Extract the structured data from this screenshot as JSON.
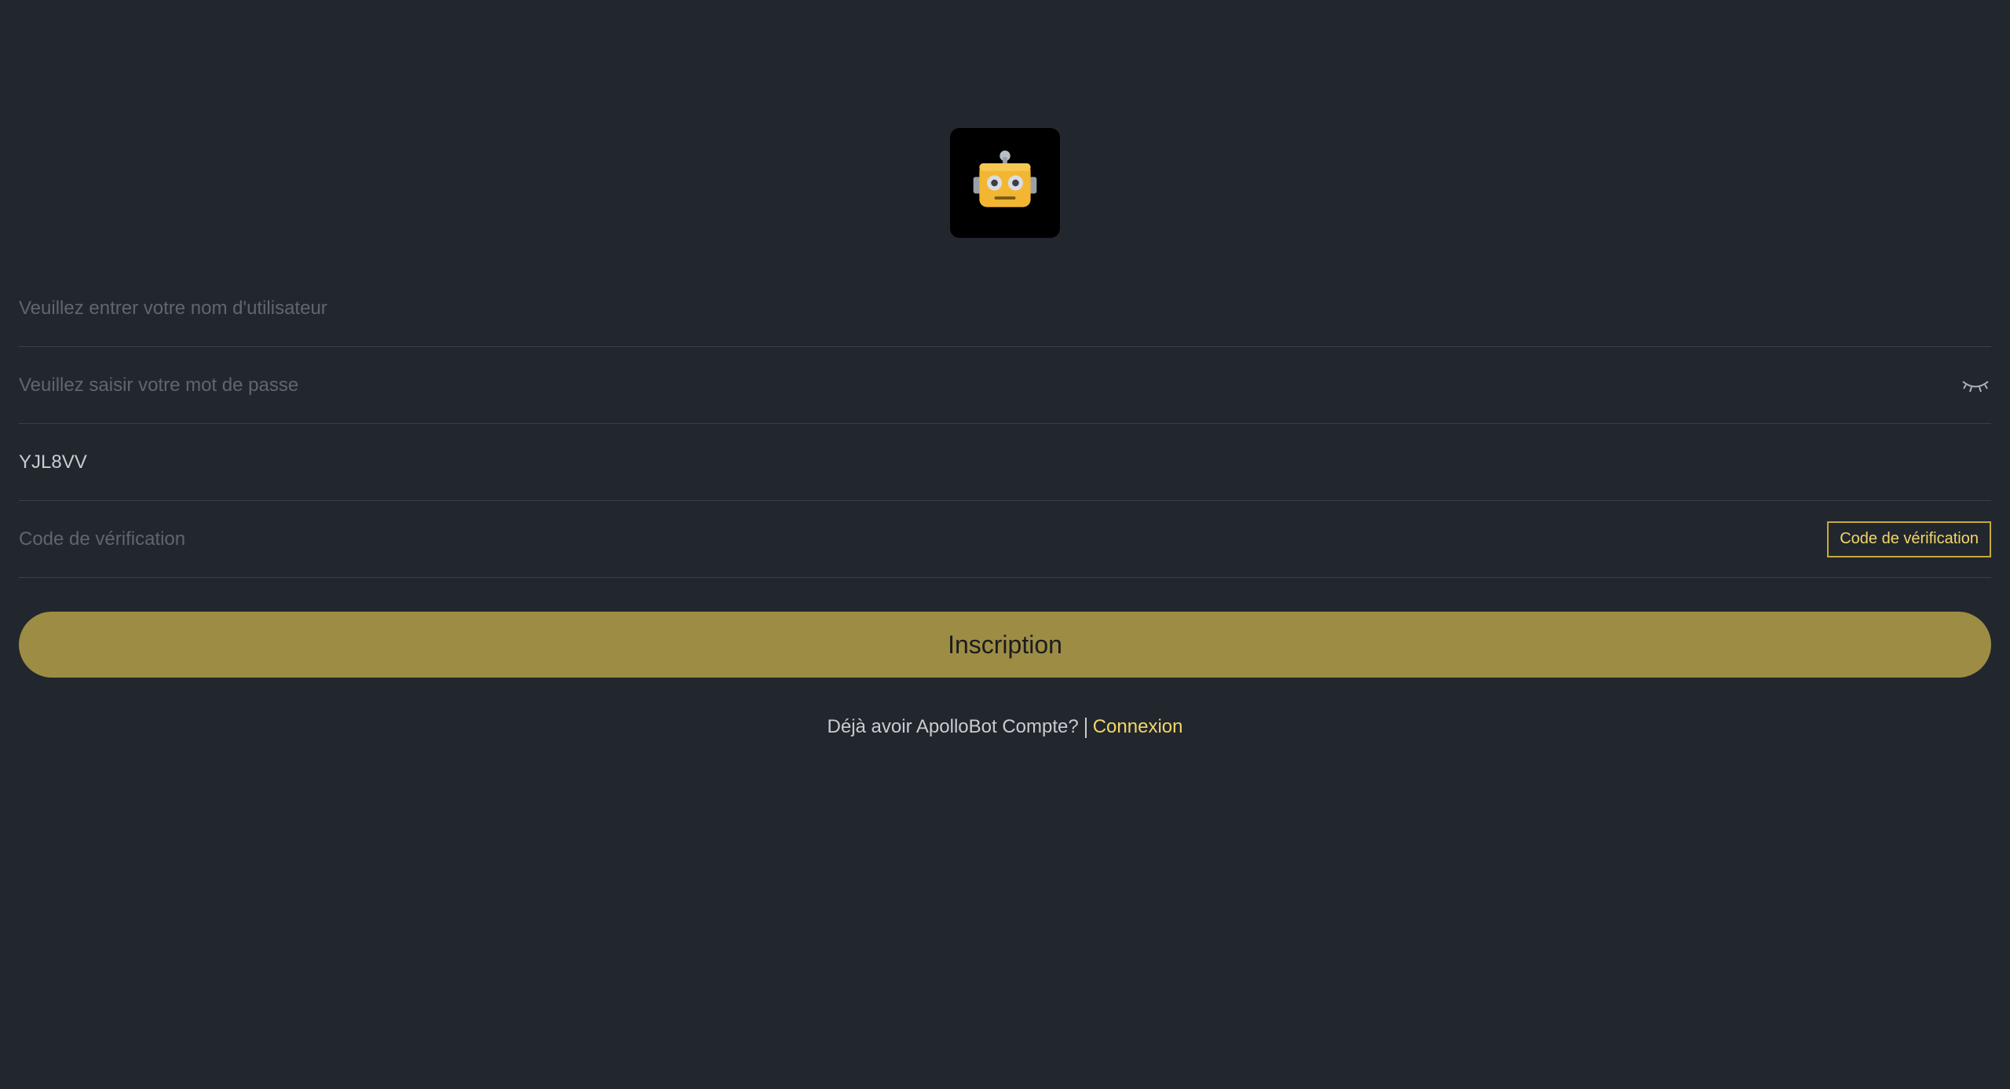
{
  "logo": {
    "icon": "robot-icon",
    "accent": "#f2b632"
  },
  "form": {
    "username_placeholder": "Veuillez entrer votre nom d'utilisateur",
    "password_placeholder": "Veuillez saisir votre mot de passe",
    "invite_code_value": "YJL8VV",
    "verification_placeholder": "Code de vérification",
    "verification_button": "Code de vérification",
    "submit_label": "Inscription"
  },
  "footer": {
    "prompt": "Déjà avoir ApolloBot Compte?",
    "login_link": "Connexion"
  },
  "colors": {
    "background": "#22272e",
    "button": "#9d8c44",
    "link": "#f3d66a"
  }
}
